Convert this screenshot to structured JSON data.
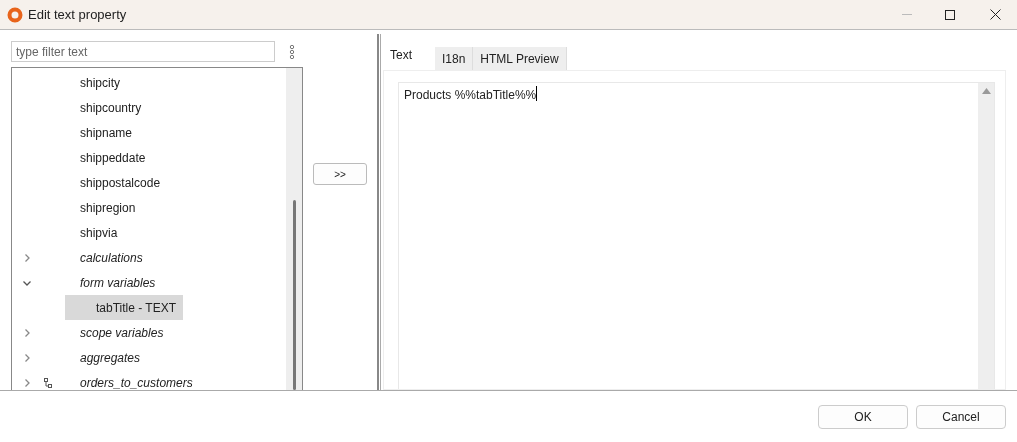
{
  "window": {
    "title": "Edit text property"
  },
  "filter": {
    "placeholder": "type filter text"
  },
  "tree": [
    {
      "label": "shipcity",
      "kind": "field"
    },
    {
      "label": "shipcountry",
      "kind": "field"
    },
    {
      "label": "shipname",
      "kind": "field"
    },
    {
      "label": "shippeddate",
      "kind": "field"
    },
    {
      "label": "shippostalcode",
      "kind": "field"
    },
    {
      "label": "shipregion",
      "kind": "field"
    },
    {
      "label": "shipvia",
      "kind": "field"
    },
    {
      "label": "calculations",
      "kind": "group",
      "expanded": false
    },
    {
      "label": "form variables",
      "kind": "group",
      "expanded": true,
      "children": [
        {
          "label": "tabTitle - TEXT",
          "kind": "variable",
          "selected": true
        }
      ]
    },
    {
      "label": "scope variables",
      "kind": "group",
      "expanded": false
    },
    {
      "label": "aggregates",
      "kind": "group",
      "expanded": false
    },
    {
      "label": "orders_to_customers",
      "kind": "relation",
      "expanded": false
    }
  ],
  "insert_button": ">>",
  "tabs": [
    {
      "label": "Text",
      "selected": true
    },
    {
      "label": "I18n",
      "selected": false
    },
    {
      "label": "HTML Preview",
      "selected": false
    }
  ],
  "editor": {
    "value": "Products %%tabTitle%%"
  },
  "buttons": [
    "OK",
    "Cancel"
  ]
}
